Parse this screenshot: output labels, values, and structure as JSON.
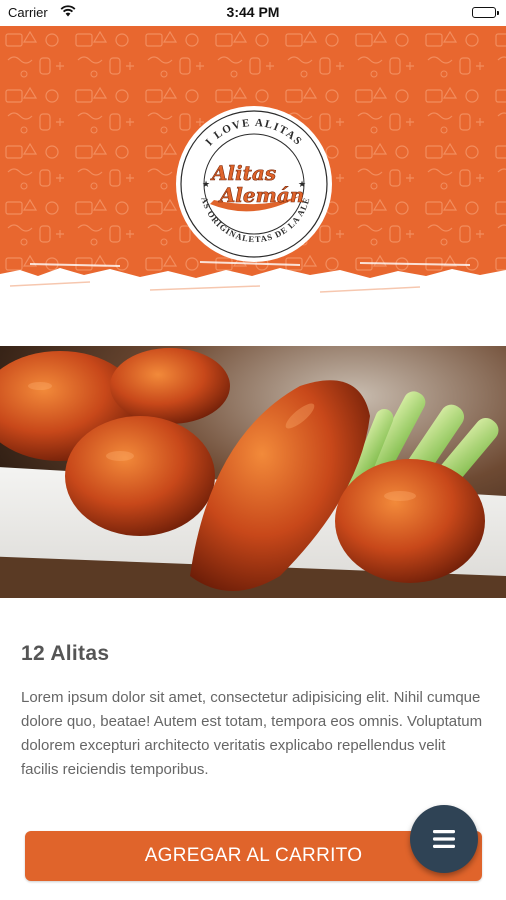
{
  "status_bar": {
    "carrier": "Carrier",
    "time": "3:44 PM",
    "wifi_icon": "wifi-icon",
    "battery_icon": "battery-icon"
  },
  "header": {
    "background_color": "#e8672f",
    "logo": {
      "top_text": "I LOVE ALITAS",
      "brand_line1": "Alitas",
      "brand_line2": "Alemán",
      "bottom_left_text": "LAS ORIGINALES",
      "bottom_right_text": "ALITAS DE LA ALEMÁN"
    }
  },
  "product": {
    "image": "chicken-wings-photo",
    "title": "12 Alitas",
    "description": "Lorem ipsum dolor sit amet, consectetur adipisicing elit. Nihil cumque dolore quo, beatae! Autem est totam, tempora eos omnis. Voluptatum dolorem excepturi architecto veritatis explicabo repellendus velit facilis reiciendis temporibus."
  },
  "actions": {
    "add_to_cart_label": "AGREGAR AL CARRITO",
    "menu_icon": "hamburger-menu-icon"
  },
  "colors": {
    "accent": "#e0642b",
    "fab": "#2f4355",
    "title_text": "#555555",
    "body_text": "#666666"
  }
}
